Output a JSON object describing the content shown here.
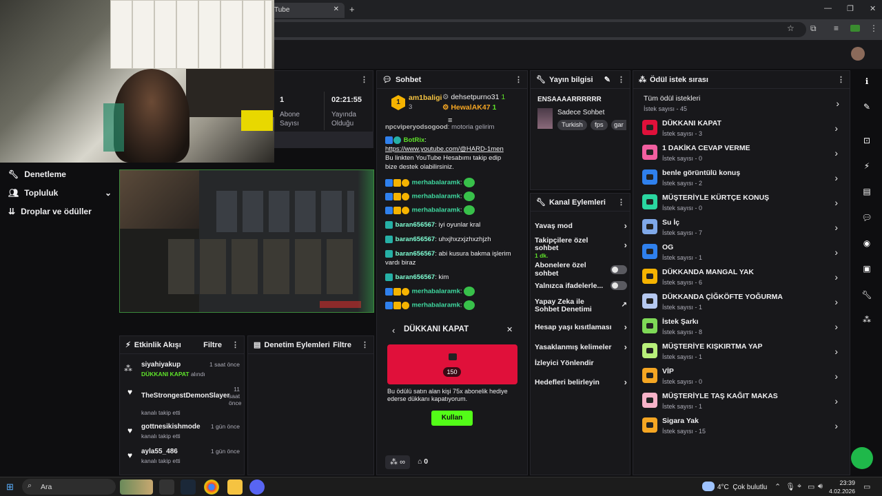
{
  "browser": {
    "tab_title": "Tube",
    "tab_close": "✕",
    "new_tab": "+"
  },
  "sidebar": {
    "items": [
      {
        "label": "Denetleme"
      },
      {
        "label": "Topluluk"
      },
      {
        "label": "Droplar ve ödüller"
      }
    ]
  },
  "stats": {
    "col1_value": "1",
    "col1_label1": "Abone",
    "col1_label2": "Sayısı",
    "col2_value": "02:21:55",
    "col2_label1": "Yayında",
    "col2_label2": "Olduğu"
  },
  "activity_feed": {
    "title": "Etkinlik Akışı",
    "filter": "Filtre",
    "items": [
      {
        "name": "siyahiyakup",
        "time": "1 saat önce",
        "sub_highlight": "DÜKKANI KAPAT",
        "sub_rest": "alındı"
      },
      {
        "name": "TheStrongestDemonSlayer",
        "time": "11 saat önce",
        "sub": "kanalı takip etti"
      },
      {
        "name": "gottnesikishmode",
        "time": "1 gün önce",
        "sub": "kanalı takip etti"
      },
      {
        "name": "ayla55_486",
        "time": "1 gün önce",
        "sub": "kanalı takip etti"
      }
    ]
  },
  "mod_actions": {
    "title": "Denetim Eylemleri",
    "filter": "Filtre"
  },
  "chat": {
    "title": "Sohbet",
    "leaderboard": {
      "rank": "1",
      "top_user": "am1baligi",
      "top_count": "3",
      "user2": "dehsetpurno31",
      "user2_count": "1",
      "user3": "HewalAK47",
      "user3_count": "1"
    },
    "messages": [
      {
        "user": "npcviperyodsogood",
        "text": "motoria gelirim"
      },
      {
        "user": "BotRix",
        "link": "https://www.youtube.com/@HARD-1men",
        "text": "Bu linkten YouTube Hesabımı takip edip bize destek olabilirsiniz."
      },
      {
        "user": "merhabalaramk",
        "text": ""
      },
      {
        "user": "merhabalaramk",
        "text": ""
      },
      {
        "user": "merhabalaramk",
        "text": ""
      },
      {
        "user": "baran656567",
        "text": "iyi oyunlar kral"
      },
      {
        "user": "baran656567",
        "text": "uhxjhxzxjzhxzhjzh"
      },
      {
        "user": "baran656567",
        "text": "abi kusura bakma işlerim vardı biraz"
      },
      {
        "user": "baran656567",
        "text": "kim"
      },
      {
        "user": "merhabalaramk",
        "text": ""
      },
      {
        "user": "merhabalaramk",
        "text": ""
      }
    ],
    "reward_popup": {
      "title": "DÜKKANI KAPAT",
      "cost": "150",
      "description": "Bu ödülü satın alan kişi 75x abonelik hediye ederse dükkanı kapatıyorum.",
      "button": "Kullan"
    },
    "footer": {
      "points": "∞",
      "store_count": "0"
    }
  },
  "stream_info": {
    "title": "Yayın bilgisi",
    "stream_title": "ENSAAAARRRRRR",
    "category": "Sadece Sohbet",
    "tags": [
      "Turkish",
      "fps",
      "gar"
    ]
  },
  "channel_actions": {
    "title": "Kanal Eylemleri",
    "items": [
      {
        "label": "Yavaş mod",
        "type": "chevron"
      },
      {
        "label": "Takipçilere özel sohbet",
        "sub": "1 dk.",
        "type": "chevron"
      },
      {
        "label": "Abonelere özel sohbet",
        "type": "toggle"
      },
      {
        "label": "Yalnızca ifadelerle...",
        "type": "toggle"
      },
      {
        "label": "Yapay Zeka ile Sohbet Denetimi",
        "type": "external"
      },
      {
        "label": "Hesap yaşı kısıtlaması",
        "type": "chevron"
      },
      {
        "label": "Yasaklanmış kelimeler",
        "type": "chevron"
      },
      {
        "label": "İzleyici Yönlendir",
        "type": "none"
      },
      {
        "label": "Hedefleri belirleyin",
        "type": "chevron"
      }
    ]
  },
  "reward_queue": {
    "title": "Ödül istek sırası",
    "all": {
      "label": "Tüm ödül istekleri",
      "sub": "İstek sayısı - 45"
    },
    "items": [
      {
        "label": "DÜKKANI KAPAT",
        "sub": "İstek sayısı - 3",
        "color": "#e0103a"
      },
      {
        "label": "1 DAKİKA CEVAP VERME",
        "sub": "İstek sayısı - 0",
        "color": "#f25fa0"
      },
      {
        "label": "benle görüntülü konuş",
        "sub": "İstek sayısı - 2",
        "color": "#2f80ed"
      },
      {
        "label": "MÜŞTERİYLE KÜRTÇE KONUŞ",
        "sub": "İstek sayısı - 0",
        "color": "#2ad6a0"
      },
      {
        "label": "Su İç",
        "sub": "İstek sayısı - 7",
        "color": "#7fa8e8"
      },
      {
        "label": "OG",
        "sub": "İstek sayısı - 1",
        "color": "#2f80ed"
      },
      {
        "label": "DÜKKANDA MANGAL YAK",
        "sub": "İstek sayısı - 6",
        "color": "#f5b301"
      },
      {
        "label": "DÜKKANDA ÇİĞKÖFTE YOĞURMA",
        "sub": "İstek sayısı - 1",
        "color": "#b5c8f0"
      },
      {
        "label": "İstek Şarkı",
        "sub": "İstek sayısı - 8",
        "color": "#7ed957"
      },
      {
        "label": "MÜŞTERİYE KIŞKIRTMA YAP",
        "sub": "İstek sayısı - 1",
        "color": "#b8ef7a"
      },
      {
        "label": "VİP",
        "sub": "İstek sayısı - 0",
        "color": "#f5a623"
      },
      {
        "label": "MÜŞTERİYLE TAŞ KAĞIT MAKAS",
        "sub": "İstek sayısı - 1",
        "color": "#f7b2c8"
      },
      {
        "label": "Sigara Yak",
        "sub": "İstek sayısı - 15",
        "color": "#f5a623"
      }
    ]
  },
  "taskbar": {
    "search": "Ara",
    "weather": "4°C  Çok bulutlu",
    "time": "23:39",
    "date": "4.02.2026"
  }
}
